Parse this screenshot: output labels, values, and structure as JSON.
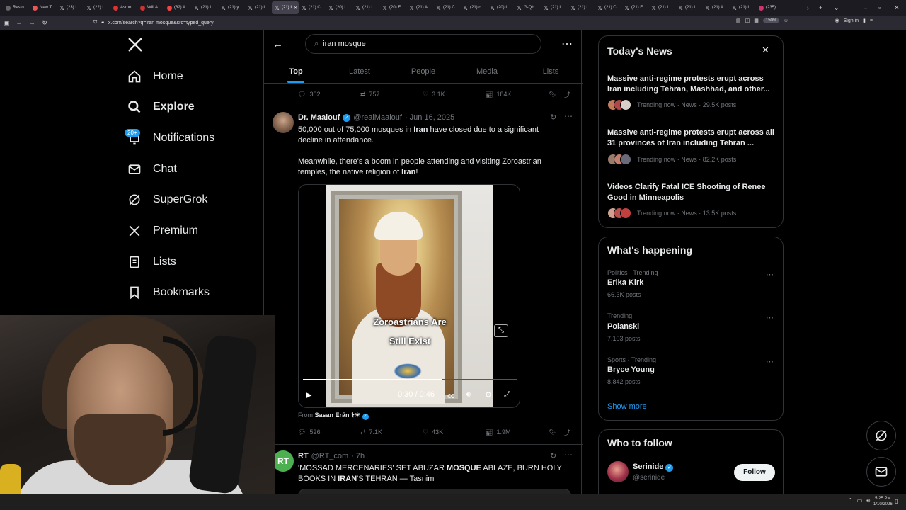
{
  "browser": {
    "tabs": [
      "Resto",
      "New T",
      "(23) I",
      "(22) I",
      "Asmo",
      "Will A",
      "(82) A",
      "(21) I",
      "(21) y",
      "(21) I",
      "(21) I",
      "(21) C",
      "(20) I",
      "(21) I",
      "(20) F",
      "(21) A",
      "(21) C",
      "(21) c",
      "(20) I",
      "G-Qb",
      "(21) I",
      "(21) I",
      "(21) C",
      "(21) F",
      "(21) I",
      "(21) I",
      "(21) A",
      "(21) I",
      "(235)"
    ],
    "url": "x.com/search?q=iran mosque&src=typed_query",
    "zoom": "150%",
    "sign_in": "Sign in"
  },
  "nav": {
    "home": "Home",
    "explore": "Explore",
    "notifications": "Notifications",
    "notif_badge": "20+",
    "chat": "Chat",
    "supergrok": "SuperGrok",
    "premium": "Premium",
    "lists": "Lists",
    "bookmarks": "Bookmarks"
  },
  "search": {
    "query": "iran mosque",
    "tabs": [
      "Top",
      "Latest",
      "People",
      "Media",
      "Lists"
    ]
  },
  "prev_post_metrics": {
    "replies": "302",
    "reposts": "757",
    "likes": "3.1K",
    "views": "184K"
  },
  "post1": {
    "name": "Dr. Maalouf",
    "handle": "@realMaalouf",
    "date": "· Jun 16, 2025",
    "text1_a": "50,000 out of 75,000 mosques in ",
    "text1_b": "Iran",
    "text1_c": " have closed due to a significant",
    "text1_d": "decline in attendance.",
    "text2_a": "Meanwhile, there's a boom in people attending and visiting Zoroastrian",
    "text2_b": "temples, the native religion of ",
    "text2_c": "Iran",
    "text2_d": "!",
    "video_caption_1": "Zoroastrians Are",
    "video_caption_2": "Still Exist",
    "video_time": "0:30 / 0:46",
    "video_progress": 0.65,
    "from_label": "From",
    "from_name": "Sasan Ērān ⚕☀",
    "metrics": {
      "replies": "526",
      "reposts": "7.1K",
      "likes": "43K",
      "views": "1.9M"
    }
  },
  "post2": {
    "avatar_text": "RT",
    "name": "RT",
    "handle": "@RT_com",
    "date": "· 7h",
    "text_a": "'MOSSAD MERCENARIES' SET ABUZAR ",
    "text_b": "MOSQUE",
    "text_c": " ABLAZE, BURN HOLY",
    "text_d": "BOOKS IN ",
    "text_e": "IRAN",
    "text_f": "'S TEHRAN — Tasnim"
  },
  "todays_news": {
    "title": "Today's News",
    "items": [
      {
        "title": "Massive anti-regime protests erupt across Iran including Tehran, Mashhad, and other...",
        "meta": "Trending now · News · 29.5K posts"
      },
      {
        "title": "Massive anti-regime protests erupt across all 31 provinces of Iran including Tehran ...",
        "meta": "Trending now · News · 82.2K posts"
      },
      {
        "title": "Videos Clarify Fatal ICE Shooting of Renee Good in Minneapolis",
        "meta": "Trending now · News · 13.5K posts"
      }
    ]
  },
  "whats_happening": {
    "title": "What's happening",
    "items": [
      {
        "category": "Politics · Trending",
        "name": "Erika Kirk",
        "count": "66.3K posts"
      },
      {
        "category": "Trending",
        "name": "Polanski",
        "count": "7,103 posts"
      },
      {
        "category": "Sports · Trending",
        "name": "Bryce Young",
        "count": "8,842 posts"
      }
    ],
    "show_more": "Show more"
  },
  "who_to_follow": {
    "title": "Who to follow",
    "name": "Serinide",
    "handle": "@serinide",
    "follow": "Follow"
  },
  "taskbar": {
    "time": "5:25 PM",
    "date": "1/10/2026"
  },
  "colors": {
    "accent": "#1d9bf0",
    "bg": "#000000",
    "border": "#2f3336",
    "muted": "#71767b"
  }
}
